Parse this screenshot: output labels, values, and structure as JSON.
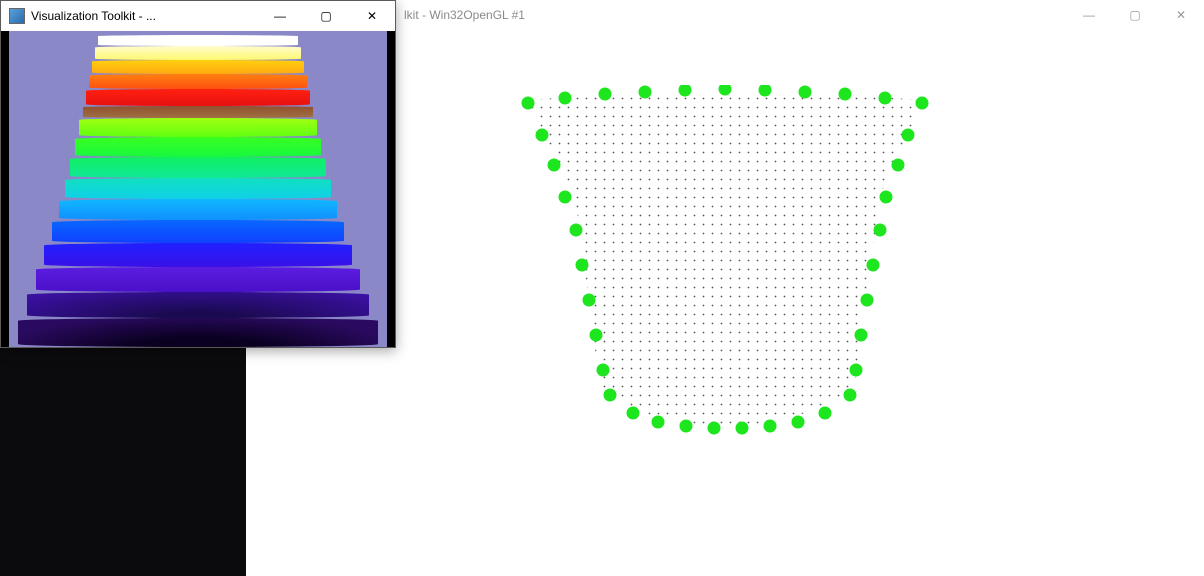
{
  "bg_window": {
    "title_partial_visible": "lkit - Win32OpenGL #1",
    "minimize": "—",
    "maximize": "▢",
    "close": "✕"
  },
  "fg_window": {
    "title": "Visualization Toolkit - ...",
    "minimize": "—",
    "maximize": "▢",
    "close": "✕"
  }
}
